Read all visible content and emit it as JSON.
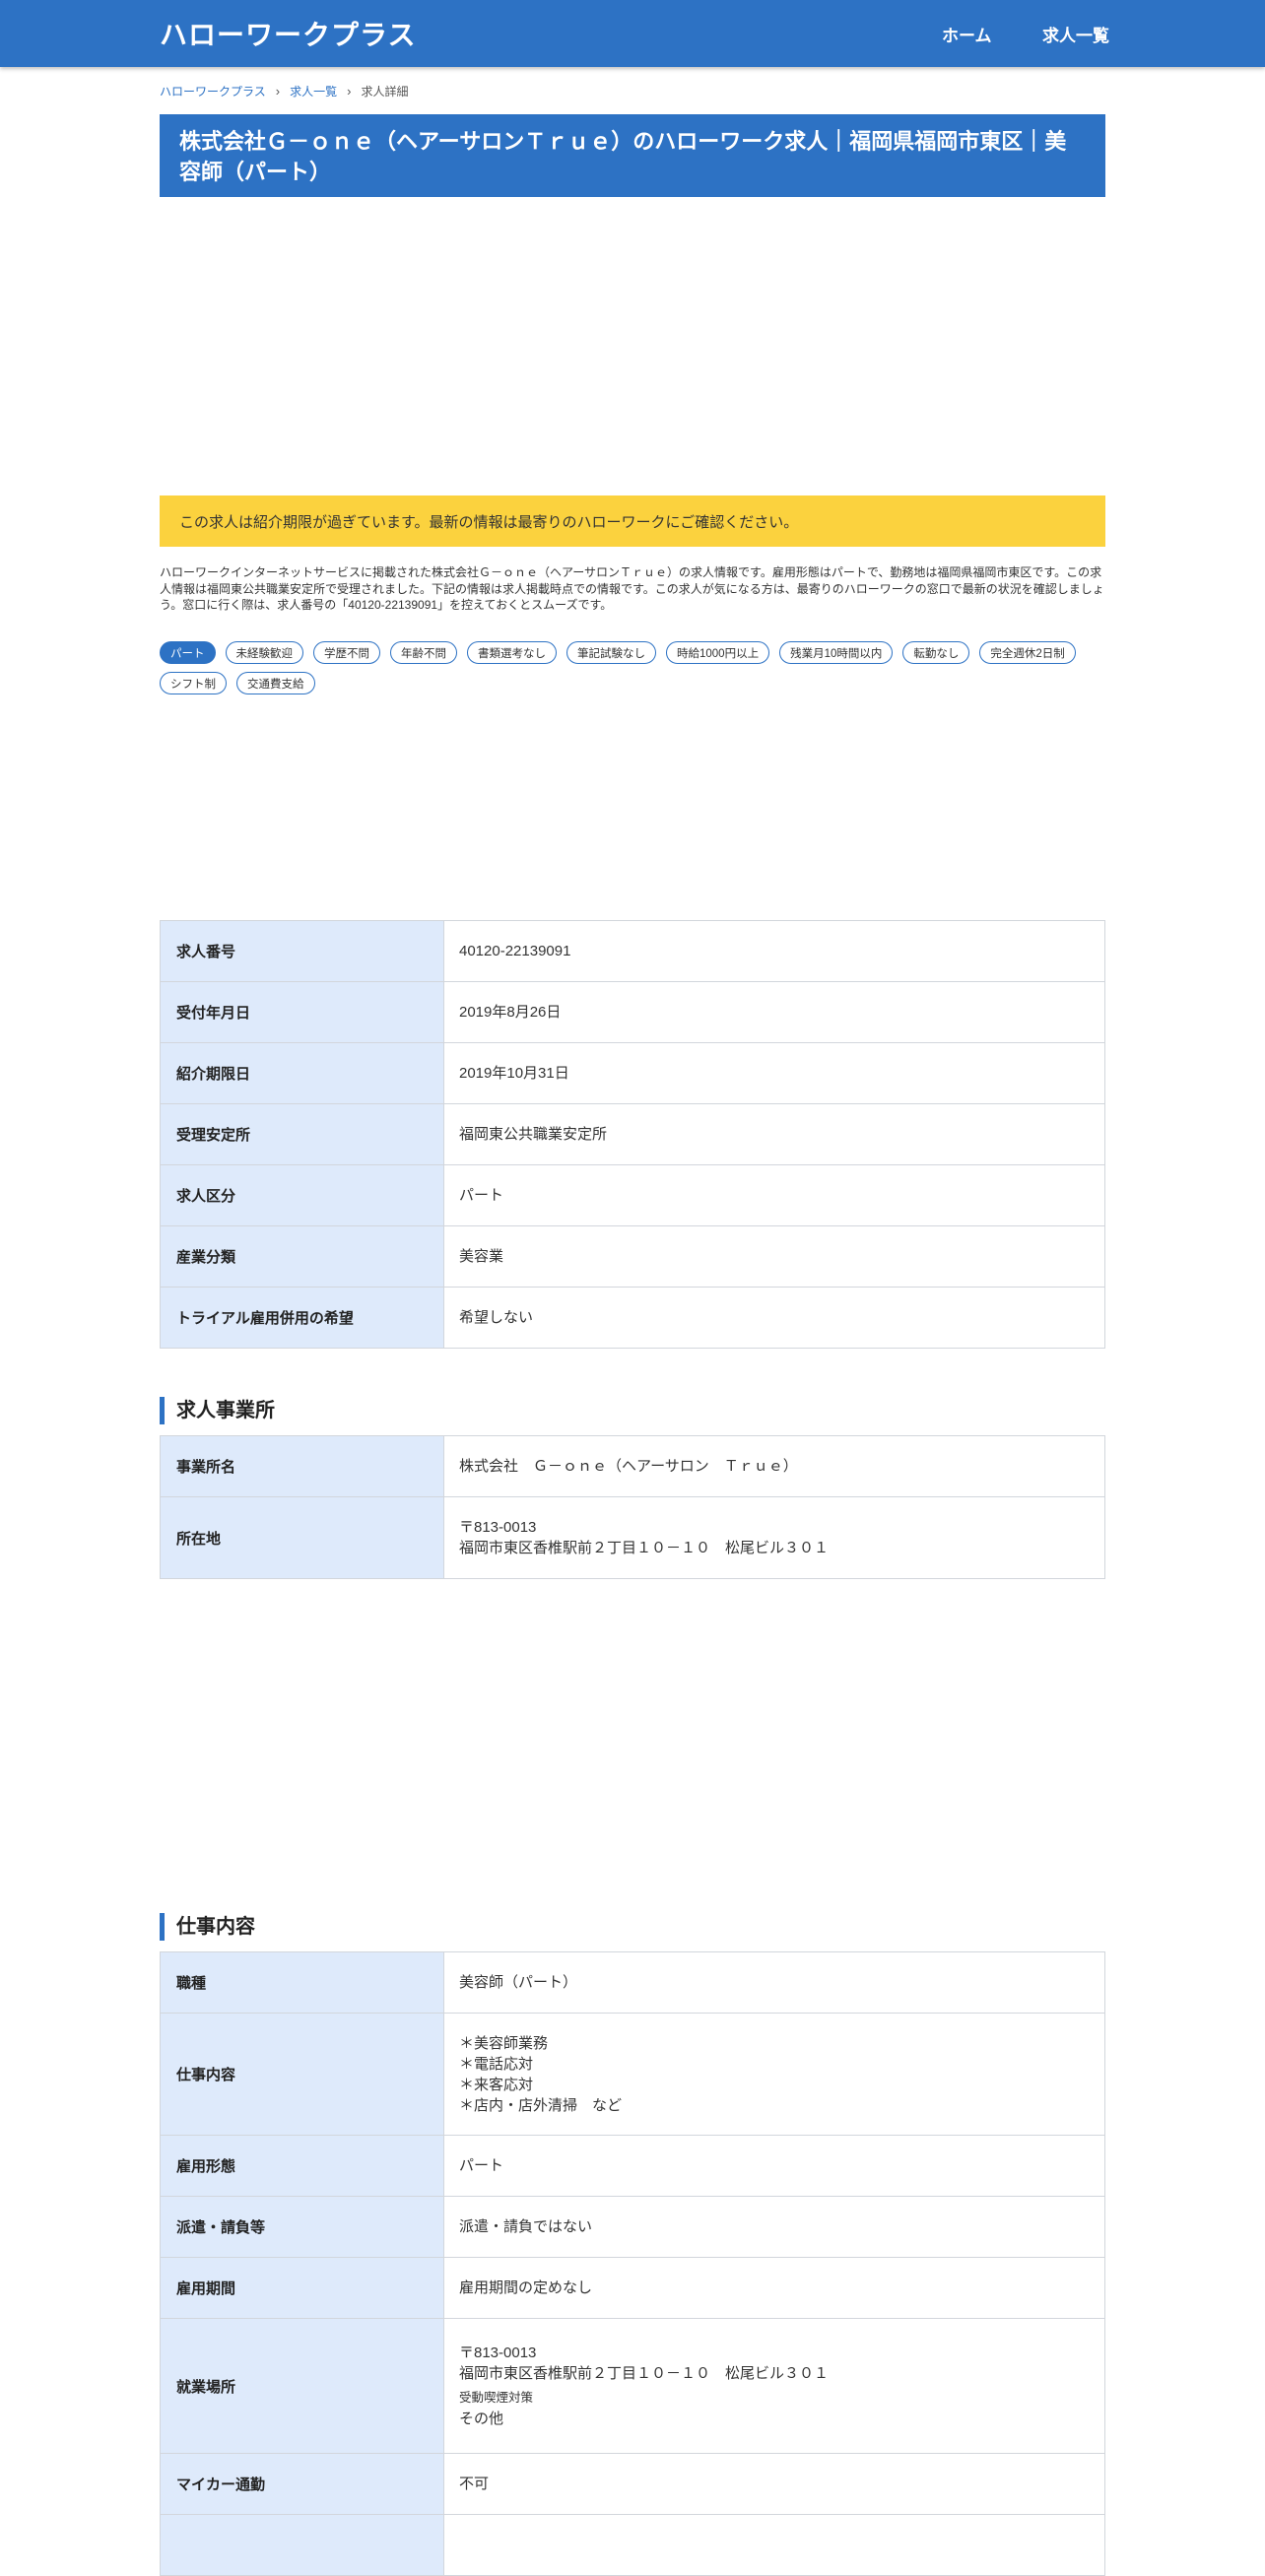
{
  "header": {
    "logo": "ハローワークプラス",
    "nav_home": "ホーム",
    "nav_list": "求人一覧"
  },
  "breadcrumb": {
    "home": "ハローワークプラス",
    "list": "求人一覧",
    "current": "求人詳細"
  },
  "title": "株式会社Ｇ－ｏｎｅ（ヘアーサロンＴｒｕｅ）のハローワーク求人｜福岡県福岡市東区｜美容師（パート）",
  "alert": "この求人は紹介期限が過ぎています。最新の情報は最寄りのハローワークにご確認ください。",
  "description": "ハローワークインターネットサービスに掲載された株式会社Ｇ－ｏｎｅ（ヘアーサロンＴｒｕｅ）の求人情報です。雇用形態はパートで、勤務地は福岡県福岡市東区です。この求人情報は福岡東公共職業安定所で受理されました。下記の情報は求人掲載時点での情報です。この求人が気になる方は、最寄りのハローワークの窓口で最新の状況を確認しましょう。窓口に行く際は、求人番号の「40120-22139091」を控えておくとスムーズです。",
  "tags": [
    "パート",
    "未経験歓迎",
    "学歴不問",
    "年齢不問",
    "書類選考なし",
    "筆記試験なし",
    "時給1000円以上",
    "残業月10時間以内",
    "転勤なし",
    "完全週休2日制",
    "シフト制",
    "交通費支給"
  ],
  "basic": {
    "rows": [
      {
        "label": "求人番号",
        "value": "40120-22139091"
      },
      {
        "label": "受付年月日",
        "value": "2019年8月26日"
      },
      {
        "label": "紹介期限日",
        "value": "2019年10月31日"
      },
      {
        "label": "受理安定所",
        "value": "福岡東公共職業安定所"
      },
      {
        "label": "求人区分",
        "value": "パート"
      },
      {
        "label": "産業分類",
        "value": "美容業"
      },
      {
        "label": "トライアル雇用併用の希望",
        "value": "希望しない"
      }
    ]
  },
  "office": {
    "heading": "求人事業所",
    "name_label": "事業所名",
    "name_value": "株式会社　Ｇ－ｏｎｅ（ヘアーサロン　Ｔｒｕｅ）",
    "address_label": "所在地",
    "postal": "〒813-0013",
    "address": "福岡市東区香椎駅前２丁目１０－１０　松尾ビル３０１"
  },
  "job": {
    "heading": "仕事内容",
    "title_label": "職種",
    "title_value": "美容師（パート）",
    "content_label": "仕事内容",
    "content_lines": [
      "＊美容師業務",
      "＊電話応対",
      "＊来客応対",
      "＊店内・店外清掃　など"
    ],
    "employment_label": "雇用形態",
    "employment_value": "パート",
    "dispatch_label": "派遣・請負等",
    "dispatch_value": "派遣・請負ではない",
    "period_label": "雇用期間",
    "period_value": "雇用期間の定めなし",
    "workplace_label": "就業場所",
    "workplace_postal": "〒813-0013",
    "workplace_address": "福岡市東区香椎駅前２丁目１０－１０　松尾ビル３０１",
    "smoking_label": "受動喫煙対策",
    "smoking_value": "その他",
    "car_label": "マイカー通勤",
    "car_value": "不可"
  }
}
